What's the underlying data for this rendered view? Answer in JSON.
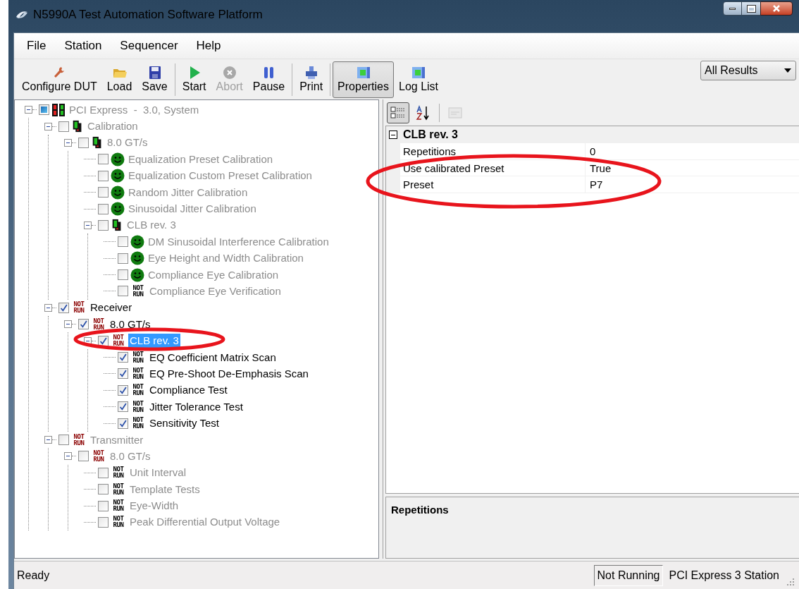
{
  "window": {
    "title": "N5990A Test Automation Software Platform"
  },
  "menu": [
    {
      "label": "File"
    },
    {
      "label": "Station"
    },
    {
      "label": "Sequencer"
    },
    {
      "label": "Help"
    }
  ],
  "toolbar": [
    {
      "kind": "wrench",
      "label": "Configure DUT",
      "disabled": false,
      "pressed": false
    },
    {
      "kind": "folder",
      "label": "Load",
      "disabled": false,
      "pressed": false
    },
    {
      "kind": "floppy",
      "label": "Save",
      "disabled": false,
      "pressed": false
    },
    {
      "kind": "separator"
    },
    {
      "kind": "play",
      "label": "Start",
      "disabled": false,
      "pressed": false
    },
    {
      "kind": "abort",
      "label": "Abort",
      "disabled": true,
      "pressed": false
    },
    {
      "kind": "pause",
      "label": "Pause",
      "disabled": false,
      "pressed": false
    },
    {
      "kind": "separator"
    },
    {
      "kind": "printer",
      "label": "Print",
      "disabled": false,
      "pressed": false
    },
    {
      "kind": "separator"
    },
    {
      "kind": "panel",
      "label": "Properties",
      "disabled": false,
      "pressed": true
    },
    {
      "kind": "panel",
      "label": "Log List",
      "disabled": false,
      "pressed": false
    }
  ],
  "results_filter": {
    "value": "All Results"
  },
  "tree": [
    {
      "label": "PCI Express  -  3.0, System",
      "checked": false,
      "partial": true,
      "kind": "system",
      "disabled": true,
      "selected": false,
      "expanded": true,
      "children": [
        {
          "label": "Calibration",
          "checked": false,
          "kind": "group",
          "disabled": true,
          "selected": false,
          "expanded": true,
          "children": [
            {
              "label": "8.0 GT/s",
              "checked": false,
              "kind": "group",
              "disabled": true,
              "selected": false,
              "expanded": true,
              "children": [
                {
                  "label": "Equalization Preset Calibration",
                  "checked": false,
                  "kind": "passed",
                  "disabled": true,
                  "selected": false
                },
                {
                  "label": "Equalization Custom Preset Calibration",
                  "checked": false,
                  "kind": "passed",
                  "disabled": true,
                  "selected": false
                },
                {
                  "label": "Random Jitter Calibration",
                  "checked": false,
                  "kind": "passed",
                  "disabled": true,
                  "selected": false
                },
                {
                  "label": "Sinusoidal Jitter Calibration",
                  "checked": false,
                  "kind": "passed",
                  "disabled": true,
                  "selected": false
                },
                {
                  "label": "CLB rev. 3",
                  "checked": false,
                  "kind": "group",
                  "disabled": true,
                  "selected": false,
                  "expanded": true,
                  "children": [
                    {
                      "label": "DM Sinusoidal Interference Calibration",
                      "checked": false,
                      "kind": "passed",
                      "disabled": true,
                      "selected": false
                    },
                    {
                      "label": "Eye Height and Width Calibration",
                      "checked": false,
                      "kind": "passed",
                      "disabled": true,
                      "selected": false
                    },
                    {
                      "label": "Compliance Eye Calibration",
                      "checked": false,
                      "kind": "passed",
                      "disabled": true,
                      "selected": false
                    },
                    {
                      "label": "Compliance Eye Verification",
                      "checked": false,
                      "kind": "not_run",
                      "badge": "NOT RUN",
                      "color": "#000000",
                      "disabled": true,
                      "selected": false
                    }
                  ]
                }
              ]
            }
          ]
        },
        {
          "label": "Receiver",
          "checked": true,
          "kind": "not_run",
          "badge": "NOT RUN",
          "color": "#8b0000",
          "disabled": false,
          "selected": false,
          "expanded": true,
          "children": [
            {
              "label": "8.0 GT/s",
              "checked": true,
              "kind": "not_run",
              "badge": "NOT RUN",
              "color": "#8b0000",
              "disabled": false,
              "selected": false,
              "expanded": true,
              "children": [
                {
                  "label": "CLB rev. 3",
                  "checked": true,
                  "kind": "not_run",
                  "badge": "NOT RUN",
                  "color": "#8b0000",
                  "disabled": false,
                  "selected": true,
                  "expanded": true,
                  "children": [
                    {
                      "label": "EQ Coefficient Matrix Scan",
                      "checked": true,
                      "kind": "not_run",
                      "badge": "NOT RUN",
                      "color": "#000000",
                      "disabled": false,
                      "selected": false
                    },
                    {
                      "label": "EQ Pre-Shoot De-Emphasis Scan",
                      "checked": true,
                      "kind": "not_run",
                      "badge": "NOT RUN",
                      "color": "#000000",
                      "disabled": false,
                      "selected": false
                    },
                    {
                      "label": "Compliance Test",
                      "checked": true,
                      "kind": "not_run",
                      "badge": "NOT RUN",
                      "color": "#000000",
                      "disabled": false,
                      "selected": false
                    },
                    {
                      "label": "Jitter Tolerance Test",
                      "checked": true,
                      "kind": "not_run",
                      "badge": "NOT RUN",
                      "color": "#000000",
                      "disabled": false,
                      "selected": false
                    },
                    {
                      "label": "Sensitivity Test",
                      "checked": true,
                      "kind": "not_run",
                      "badge": "NOT RUN",
                      "color": "#000000",
                      "disabled": false,
                      "selected": false
                    }
                  ]
                }
              ]
            }
          ]
        },
        {
          "label": "Transmitter",
          "checked": false,
          "kind": "not_run",
          "badge": "NOT RUN",
          "color": "#8b0000",
          "disabled": true,
          "selected": false,
          "expanded": true,
          "children": [
            {
              "label": "8.0 GT/s",
              "checked": false,
              "kind": "not_run",
              "badge": "NOT RUN",
              "color": "#8b0000",
              "disabled": true,
              "selected": false,
              "expanded": true,
              "children": [
                {
                  "label": "Unit Interval",
                  "checked": false,
                  "kind": "not_run",
                  "badge": "NOT RUN",
                  "color": "#000000",
                  "disabled": true,
                  "selected": false
                },
                {
                  "label": "Template Tests",
                  "checked": false,
                  "kind": "not_run",
                  "badge": "NOT RUN",
                  "color": "#000000",
                  "disabled": true,
                  "selected": false
                },
                {
                  "label": "Eye-Width",
                  "checked": false,
                  "kind": "not_run",
                  "badge": "NOT RUN",
                  "color": "#000000",
                  "disabled": true,
                  "selected": false
                },
                {
                  "label": "Peak Differential Output Voltage",
                  "checked": false,
                  "kind": "not_run",
                  "badge": "NOT RUN",
                  "color": "#000000",
                  "disabled": true,
                  "selected": false
                }
              ]
            }
          ]
        }
      ]
    }
  ],
  "properties": {
    "toolbar": [
      {
        "kind": "categorized",
        "pressed": true,
        "disabled": false
      },
      {
        "kind": "alphabetical",
        "pressed": false,
        "disabled": false
      },
      {
        "kind": "separator"
      },
      {
        "kind": "pages",
        "pressed": false,
        "disabled": true
      }
    ],
    "category": {
      "label": "CLB rev. 3",
      "expanded": true
    },
    "rows": [
      {
        "name": "Repetitions",
        "value": "0"
      },
      {
        "name": "Use calibrated Preset",
        "value": "True"
      },
      {
        "name": "Preset",
        "value": "P7"
      }
    ],
    "description": {
      "title": "Repetitions"
    }
  },
  "status_bar": {
    "message": "Ready",
    "run_state": "Not Running",
    "station": "PCI Express 3 Station"
  }
}
